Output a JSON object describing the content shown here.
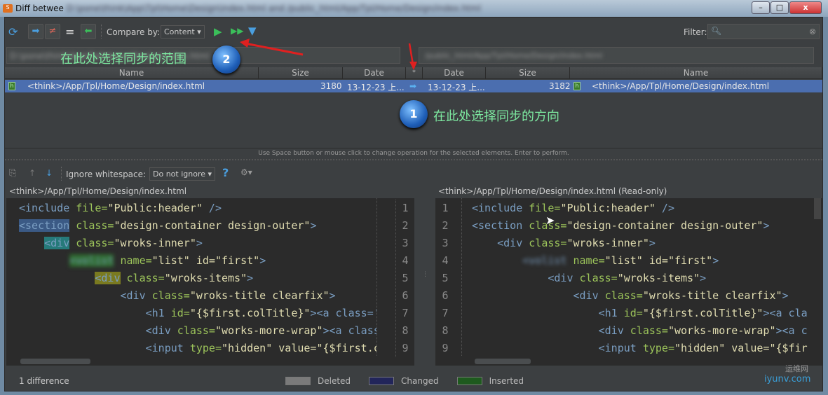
{
  "window": {
    "title": "Diff betwee",
    "controls": [
      "–",
      "□",
      "x"
    ]
  },
  "toolbar": {
    "compare_by_label": "Compare by:",
    "compare_by_value": "Content",
    "filter_label": "Filter:",
    "filter_value": ""
  },
  "paths": {
    "left_blurred": "D:\\pone\\think\\App\\Tpl\\Home\\Design\\index.html",
    "right_blurred": "/public_html/App/Tpl/Home/Design/index.html"
  },
  "table": {
    "headers": {
      "left_name": "Name",
      "left_size": "Size",
      "left_date": "Date",
      "op": "*",
      "right_date": "Date",
      "right_size": "Size",
      "right_name": "Name"
    },
    "row": {
      "left_name": "<think>/App/Tpl/Home/Design/index.html",
      "left_size": "3180",
      "left_date": "13-12-23 上...",
      "right_date": "13-12-23 上...",
      "right_size": "3182",
      "right_name": "<think>/App/Tpl/Home/Design/index.html"
    }
  },
  "hint": "Use Space button or mouse click to change operation for the selected elements. Enter to perform.",
  "diff_toolbar": {
    "ignore_ws_label": "Ignore whitespace:",
    "ignore_ws_value": "Do not ignore",
    "help": "?"
  },
  "left_title": "<think>/App/Tpl/Home/Design/index.html",
  "right_title": "<think>/App/Tpl/Home/Design/index.html (Read-only)",
  "line_numbers": [
    "1",
    "2",
    "3",
    "4",
    "5",
    "6",
    "7",
    "8",
    "9"
  ],
  "left_code": [
    [
      "",
      "<include",
      " file=",
      "\"Public:header\"",
      " />"
    ],
    [
      "",
      "<section",
      " class=",
      "\"design-container design-outer\"",
      ">"
    ],
    [
      "    ",
      "<div",
      " class=",
      "\"wroks-inner\"",
      ">"
    ],
    [
      "        ",
      "<volist",
      " name=",
      "\"list\" id=\"first\"",
      ">"
    ],
    [
      "            ",
      "<div",
      " class=",
      "\"wroks-items\"",
      ">"
    ],
    [
      "                ",
      "<div",
      " class=",
      "\"wroks-title clearfix\"",
      ">"
    ],
    [
      "                    ",
      "<h1",
      " id=",
      "\"{$first.colTitle}\"",
      "><a class='"
    ],
    [
      "                    ",
      "<div",
      " class=",
      "\"works-more-wrap\"",
      "><a class"
    ],
    [
      "                    ",
      "<input",
      " type=",
      "\"hidden\" value=\"{$first.c",
      ""
    ]
  ],
  "right_code": [
    [
      "",
      "<include",
      " file=",
      "\"Public:header\"",
      " />"
    ],
    [
      "",
      "<section",
      " class=",
      "\"design-container design-outer\"",
      ">"
    ],
    [
      "    ",
      "<div",
      " class=",
      "\"wroks-inner\"",
      ">"
    ],
    [
      "        ",
      "<volist",
      " name=",
      "\"list\" id=\"first\"",
      ">"
    ],
    [
      "            ",
      "<div",
      " class=",
      "\"wroks-items\"",
      ">"
    ],
    [
      "                ",
      "<div",
      " class=",
      "\"wroks-title clearfix\"",
      ">"
    ],
    [
      "                    ",
      "<h1",
      " id=",
      "\"{$first.colTitle}\"",
      "><a cla"
    ],
    [
      "                    ",
      "<div",
      " class=",
      "\"works-more-wrap\"",
      "><a c"
    ],
    [
      "                    ",
      "<input",
      " type=",
      "\"hidden\" value=\"{$fir",
      ""
    ]
  ],
  "status": {
    "differences": "1 difference",
    "legend": [
      {
        "label": "Deleted",
        "color": "#7a7a7a"
      },
      {
        "label": "Changed",
        "color": "#22255a"
      },
      {
        "label": "Inserted",
        "color": "#1e5a1e"
      }
    ]
  },
  "annotations": {
    "note_scope": "在此处选择同步的范围",
    "note_direction": "在此处选择同步的方向",
    "badge_1": "1",
    "badge_2": "2"
  },
  "watermark": {
    "cn": "运维网",
    "en": "iyunv.com"
  },
  "colors": {
    "selection": "#4b6eaf",
    "background": "#3c3f41",
    "editor": "#2b2b2b",
    "annotation": "#7de8a0",
    "arrow": "#e02020"
  }
}
